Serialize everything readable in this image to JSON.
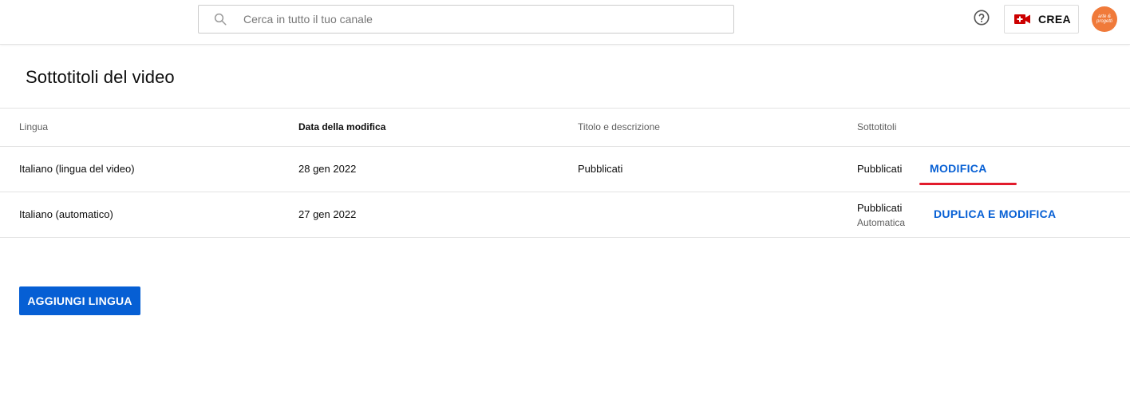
{
  "header": {
    "search_placeholder": "Cerca in tutto il tuo canale",
    "create_label": "CREA",
    "avatar_text": "arte & progetti"
  },
  "page": {
    "title": "Sottotitoli del video"
  },
  "table": {
    "columns": [
      "Lingua",
      "Data della modifica",
      "Titolo e descrizione",
      "Sottotitoli"
    ],
    "rows": [
      {
        "language": "Italiano (lingua del video)",
        "date": "28 gen 2022",
        "title_desc": "Pubblicati",
        "subtitles": "Pubblicati",
        "subtitles_sub": "",
        "action": "MODIFICA"
      },
      {
        "language": "Italiano (automatico)",
        "date": "27 gen 2022",
        "title_desc": "",
        "subtitles": "Pubblicati",
        "subtitles_sub": "Automatica",
        "action": "DUPLICA E MODIFICA"
      }
    ]
  },
  "add_language_label": "AGGIUNGI LINGUA",
  "colors": {
    "accent_blue": "#065fd4",
    "highlight_red": "#e21b2c",
    "camera_red": "#cc0000",
    "avatar": "#f07a3a"
  },
  "icons": [
    "search-icon",
    "help-icon",
    "video-camera-icon"
  ]
}
